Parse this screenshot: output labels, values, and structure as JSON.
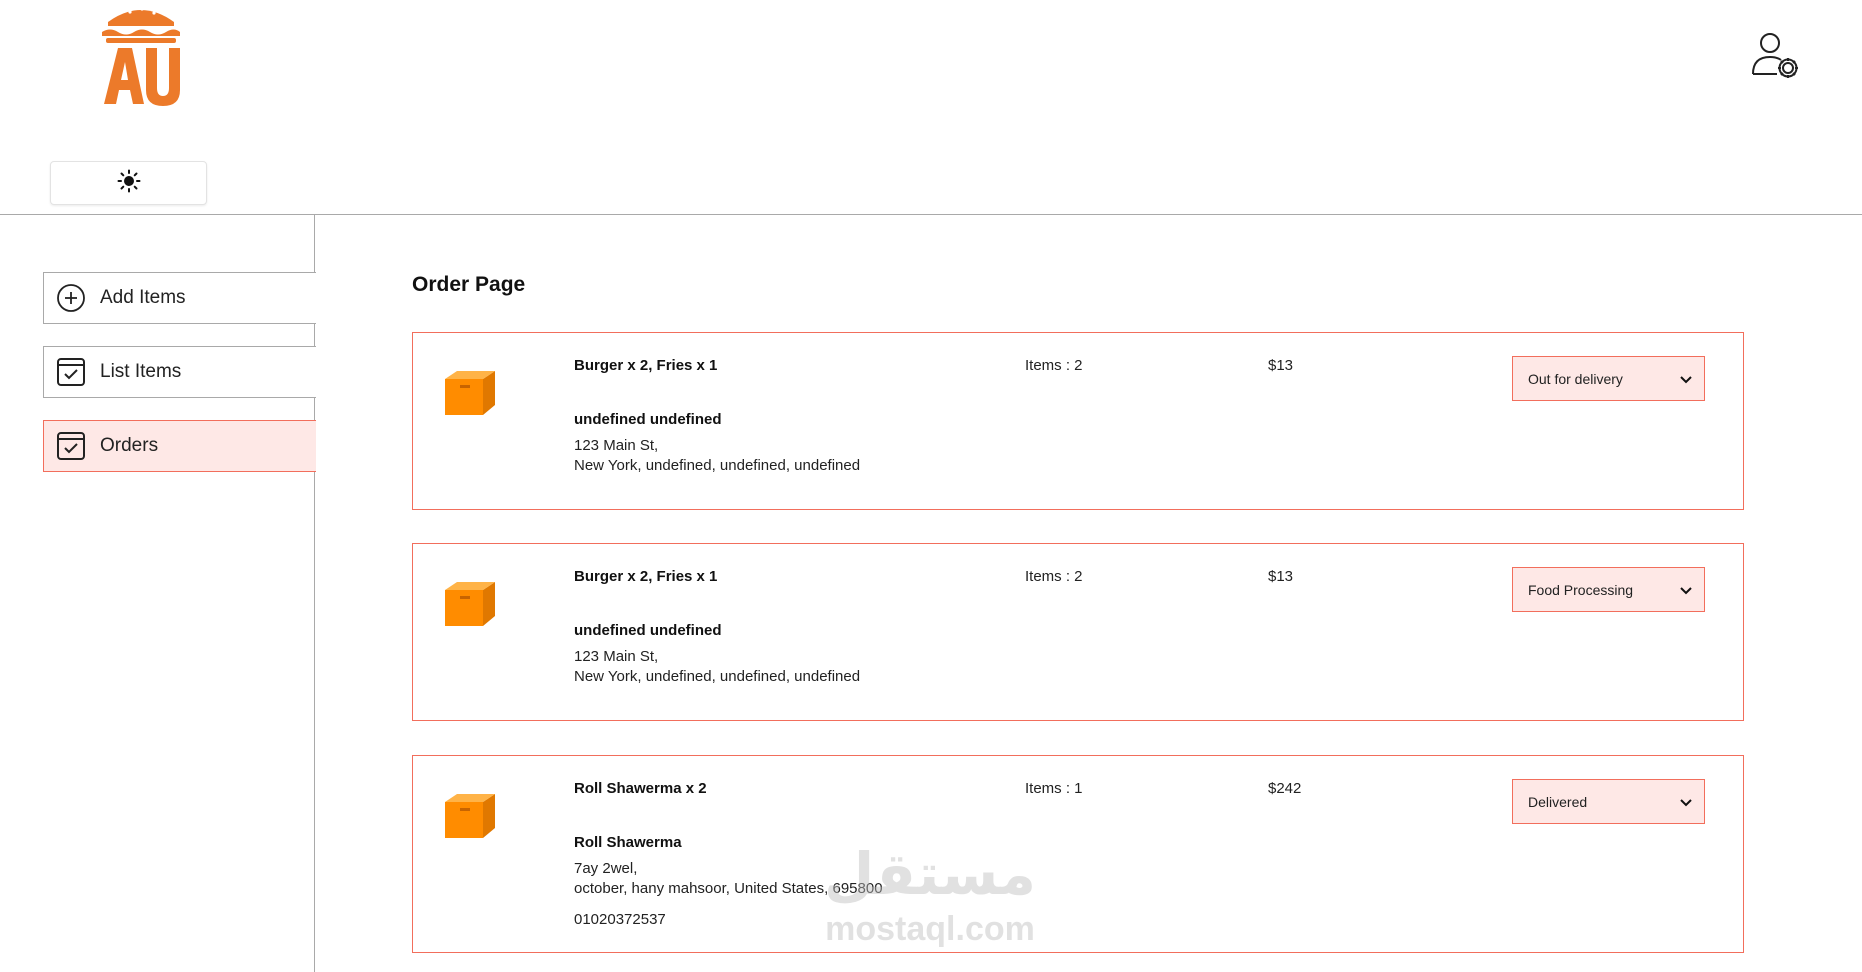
{
  "header": {
    "logo_text": "AU",
    "theme_toggle_icon": "sun-icon",
    "profile_icon": "user-settings-icon"
  },
  "sidebar": {
    "items": [
      {
        "label": "Add Items",
        "icon": "plus-circle-icon",
        "active": false
      },
      {
        "label": "List Items",
        "icon": "calendar-check-icon",
        "active": false
      },
      {
        "label": "Orders",
        "icon": "calendar-check-icon",
        "active": true
      }
    ]
  },
  "main": {
    "title": "Order Page",
    "orders": [
      {
        "items": "Burger x 2, Fries x 1",
        "customer": "undefined undefined",
        "address_line1": "123 Main St,",
        "address_line2": "New York, undefined, undefined, undefined",
        "phone": "",
        "count": "Items : 2",
        "amount": "$13",
        "status": "Out for delivery"
      },
      {
        "items": "Burger x 2, Fries x 1",
        "customer": "undefined undefined",
        "address_line1": "123 Main St,",
        "address_line2": "New York, undefined, undefined, undefined",
        "phone": "",
        "count": "Items : 2",
        "amount": "$13",
        "status": "Food Processing"
      },
      {
        "items": "Roll Shawerma x 2",
        "customer": "Roll Shawerma",
        "address_line1": "7ay 2wel,",
        "address_line2": "october, hany mahsoor, United States, 695800",
        "phone": "01020372537",
        "count": "Items : 1",
        "amount": "$242",
        "status": "Delivered"
      }
    ]
  },
  "watermark": {
    "arabic": "مستقل",
    "latin": "mostaql.com"
  },
  "colors": {
    "accent": "#f26e5c",
    "accent_bg": "#fee8e6",
    "brand_orange": "#ec7a2a",
    "box_orange": "#ff8c00"
  }
}
